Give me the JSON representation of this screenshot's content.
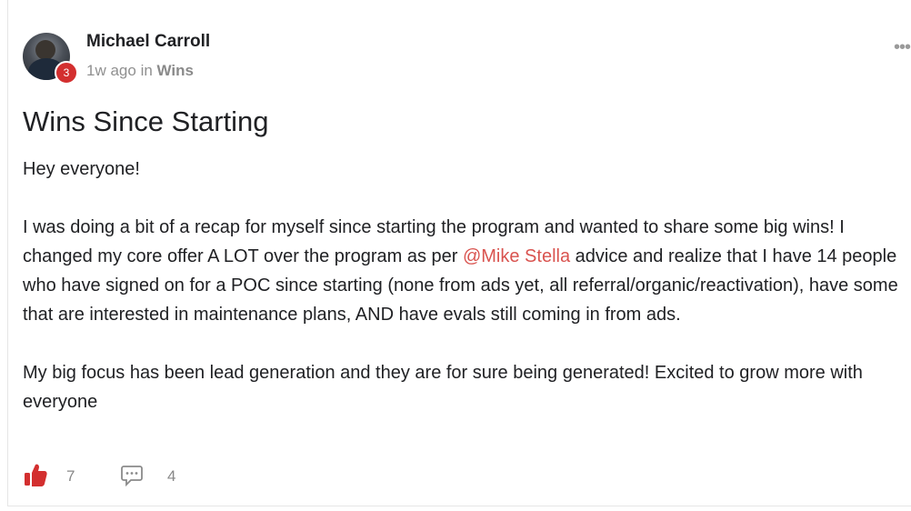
{
  "post": {
    "author_name": "Michael Carroll",
    "level": "3",
    "time_ago": "1w ago",
    "in_word": "in",
    "category": "Wins",
    "more_icon": "more-horizontal-icon",
    "title": "Wins Since Starting",
    "greeting": "Hey everyone!",
    "paragraph1_before": "I was doing a bit of a recap for myself since starting the program and wanted to share some big wins! I changed my core offer A LOT over the program as per ",
    "mention": "@Mike Stella",
    "paragraph1_after": " advice and realize that I have 14 people who have signed on for a POC since starting (none from ads yet, all referral/organic/reactivation), have some that are interested in maintenance plans, AND have evals still coming in from ads.",
    "paragraph2": "My big focus has been lead generation and they are for sure being generated! Excited to grow more with everyone",
    "likes": "7",
    "comments": "4"
  },
  "icons": {
    "like": "thumbs-up-icon",
    "comment": "comment-icon"
  },
  "colors": {
    "accent": "#d9534f",
    "badge": "#d32f2f",
    "like": "#d32f2f",
    "text": "#202124",
    "muted": "#909090"
  }
}
